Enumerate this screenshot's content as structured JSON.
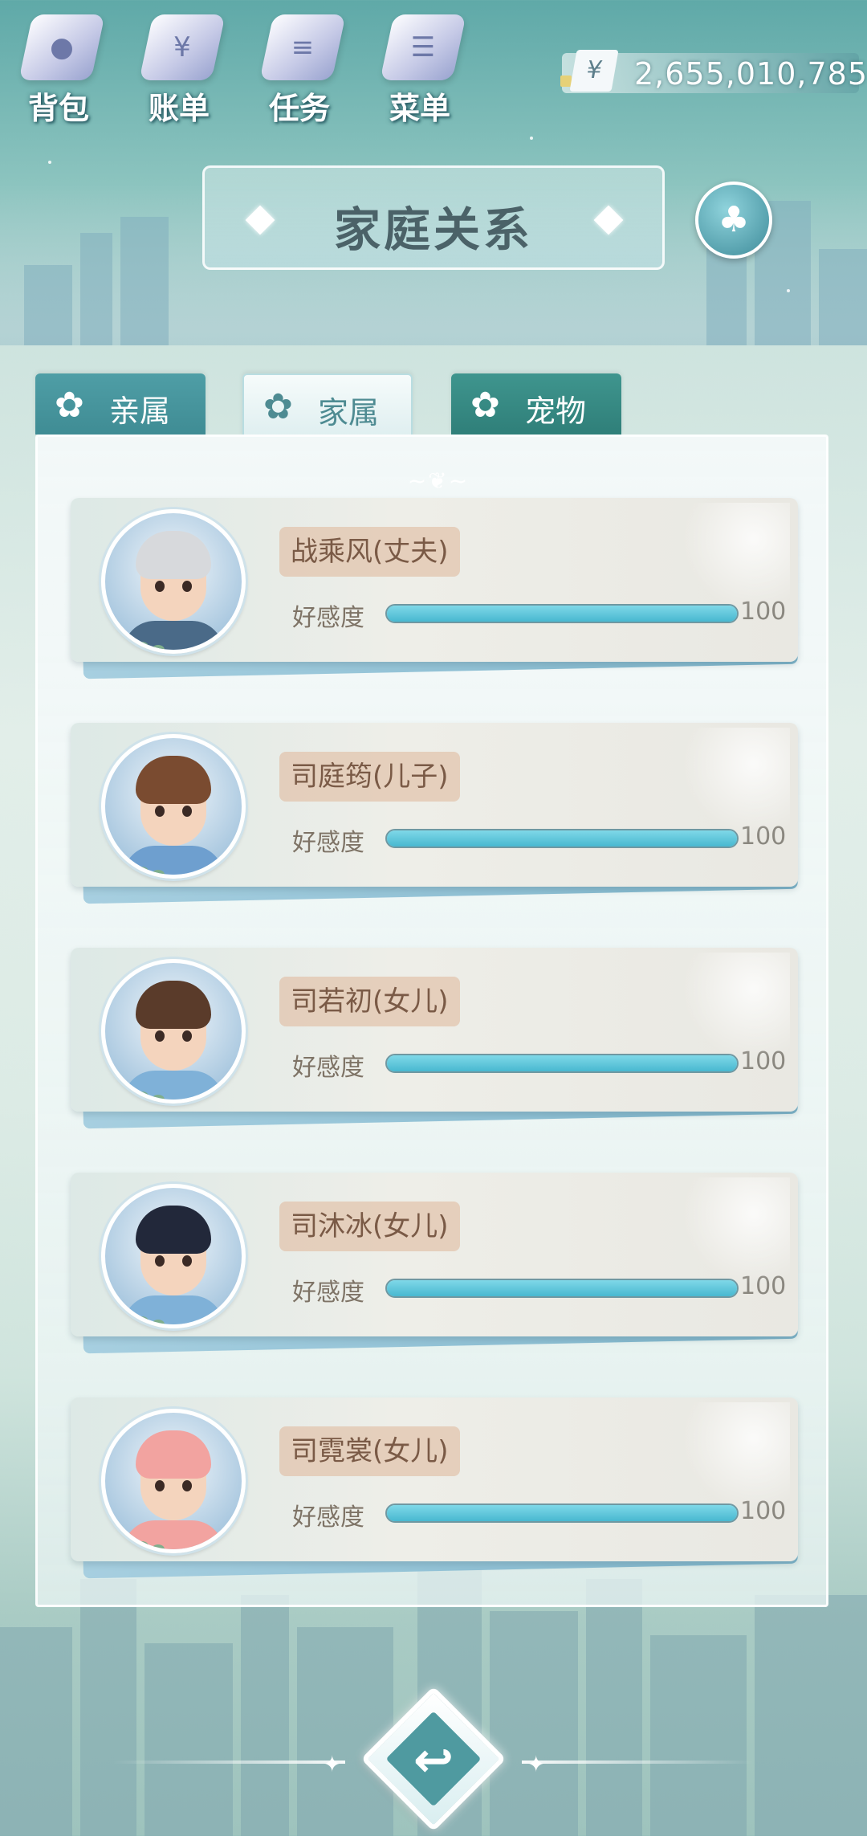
{
  "topnav": {
    "items": [
      {
        "label": "背包",
        "icon": "backpack-icon",
        "glyph": "●"
      },
      {
        "label": "账单",
        "icon": "bill-icon",
        "glyph": "¥"
      },
      {
        "label": "任务",
        "icon": "task-icon",
        "glyph": "≡"
      },
      {
        "label": "菜单",
        "icon": "menu-icon",
        "glyph": "☰"
      }
    ],
    "currency_symbol": "¥",
    "currency_amount": "2,655,010,785"
  },
  "header": {
    "title": "家庭关系"
  },
  "tabs": [
    {
      "label": "亲属",
      "active": false
    },
    {
      "label": "家属",
      "active": true
    },
    {
      "label": "宠物",
      "active": false
    }
  ],
  "members": [
    {
      "name": "战乘风(丈夫)",
      "favor_label": "好感度",
      "favor_value": "100",
      "favor_percent": 100,
      "hair_color": "#d7d9dc",
      "shirt_color": "#4a6a88"
    },
    {
      "name": "司庭筠(儿子)",
      "favor_label": "好感度",
      "favor_value": "100",
      "favor_percent": 100,
      "hair_color": "#7a4b30",
      "shirt_color": "#6e9fcf"
    },
    {
      "name": "司若初(女儿)",
      "favor_label": "好感度",
      "favor_value": "100",
      "favor_percent": 100,
      "hair_color": "#5a3b2a",
      "shirt_color": "#7fb1d8"
    },
    {
      "name": "司沐冰(女儿)",
      "favor_label": "好感度",
      "favor_value": "100",
      "favor_percent": 100,
      "hair_color": "#22283a",
      "shirt_color": "#7fb1d8"
    },
    {
      "name": "司霓裳(女儿)",
      "favor_label": "好感度",
      "favor_value": "100",
      "favor_percent": 100,
      "hair_color": "#f2a3a0",
      "shirt_color": "#f2a3a0"
    }
  ],
  "colors": {
    "bar_fill": "#48b8d0",
    "tab_active_text": "#4e8b92",
    "name_tag_bg": "#e2c4ae"
  }
}
